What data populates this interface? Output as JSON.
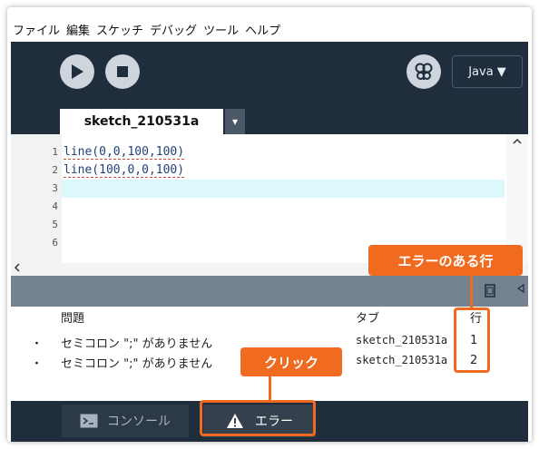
{
  "menubar": {
    "items": [
      "ファイル",
      "編集",
      "スケッチ",
      "デバッグ",
      "ツール",
      "ヘルプ"
    ]
  },
  "toolbar": {
    "mode_label": "Java ▼"
  },
  "editor": {
    "tab_label": "sketch_210531a",
    "tab_menu_glyph": "▾",
    "line_numbers": [
      "1",
      "2",
      "3",
      "4",
      "5",
      "6"
    ],
    "code_lines": [
      "line(0,0,100,100)",
      "line(100,0,0,100)"
    ]
  },
  "errors": {
    "headers": {
      "problem": "問題",
      "tab": "タブ",
      "line": "行"
    },
    "rows": [
      {
        "bullet": "・",
        "problem": "セミコロン \";\" がありません",
        "tab": "sketch_210531a",
        "line": "1"
      },
      {
        "bullet": "・",
        "problem": "セミコロン \";\" がありません",
        "tab": "sketch_210531a",
        "line": "2"
      }
    ]
  },
  "bottom_tabs": {
    "console": "コンソール",
    "errors": "エラー"
  },
  "annotations": {
    "line_column": "エラーのある行",
    "click": "クリック"
  },
  "colors": {
    "accent": "#f06b20",
    "toolbar_bg": "#1f2d3d"
  }
}
